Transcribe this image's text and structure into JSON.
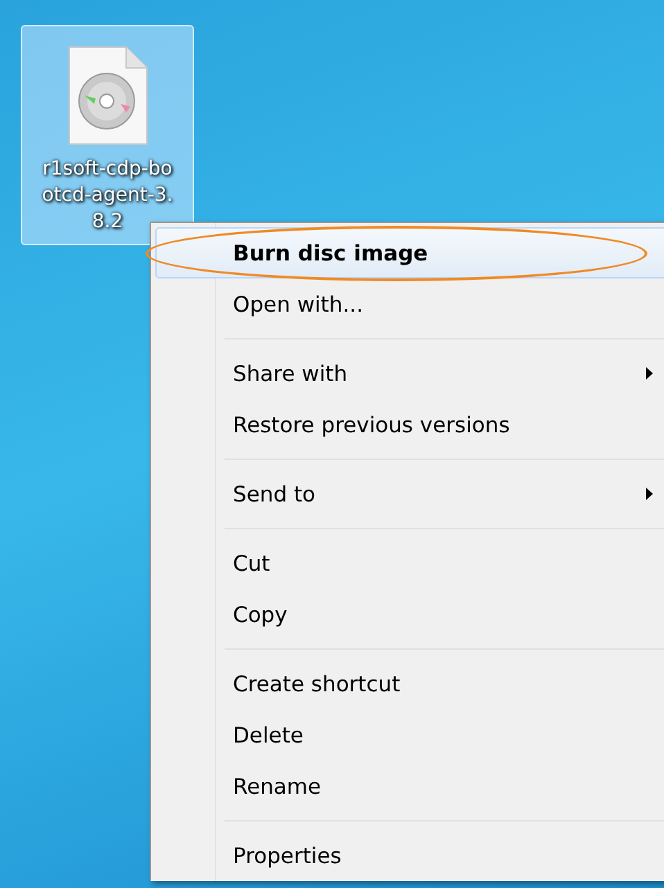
{
  "desktop_icon": {
    "label": "r1soft-cdp-bootcd-agent-3.8.2",
    "selected": true
  },
  "context_menu": {
    "items": [
      {
        "kind": "item",
        "label": "Burn disc image",
        "bold": true,
        "selected": true,
        "submenu": false
      },
      {
        "kind": "item",
        "label": "Open with...",
        "bold": false,
        "selected": false,
        "submenu": false
      },
      {
        "kind": "separator"
      },
      {
        "kind": "item",
        "label": "Share with",
        "bold": false,
        "selected": false,
        "submenu": true
      },
      {
        "kind": "item",
        "label": "Restore previous versions",
        "bold": false,
        "selected": false,
        "submenu": false
      },
      {
        "kind": "separator"
      },
      {
        "kind": "item",
        "label": "Send to",
        "bold": false,
        "selected": false,
        "submenu": true
      },
      {
        "kind": "separator"
      },
      {
        "kind": "item",
        "label": "Cut",
        "bold": false,
        "selected": false,
        "submenu": false
      },
      {
        "kind": "item",
        "label": "Copy",
        "bold": false,
        "selected": false,
        "submenu": false
      },
      {
        "kind": "separator"
      },
      {
        "kind": "item",
        "label": "Create shortcut",
        "bold": false,
        "selected": false,
        "submenu": false
      },
      {
        "kind": "item",
        "label": "Delete",
        "bold": false,
        "selected": false,
        "submenu": false
      },
      {
        "kind": "item",
        "label": "Rename",
        "bold": false,
        "selected": false,
        "submenu": false
      },
      {
        "kind": "separator"
      },
      {
        "kind": "item",
        "label": "Properties",
        "bold": false,
        "selected": false,
        "submenu": false
      }
    ]
  }
}
